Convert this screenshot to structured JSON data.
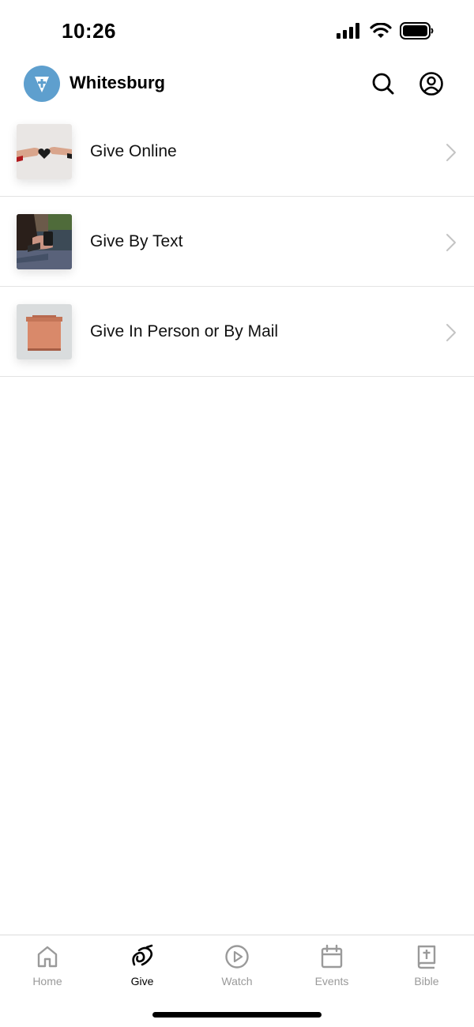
{
  "status_bar": {
    "time": "10:26",
    "icons": [
      "cellular-signal-icon",
      "wifi-icon",
      "battery-icon"
    ]
  },
  "header": {
    "church_name": "Whitesburg",
    "logo_color": "#5e9fce",
    "actions": [
      "search-icon",
      "account-icon"
    ]
  },
  "give_options": [
    {
      "label": "Give Online",
      "thumbnail": "hands-passing-heart"
    },
    {
      "label": "Give By Text",
      "thumbnail": "person-holding-phone"
    },
    {
      "label": "Give In Person or By Mail",
      "thumbnail": "copper-mailbox"
    }
  ],
  "tab_bar": {
    "active_color": "#000000",
    "inactive_color": "#9a9a9a",
    "tabs": [
      {
        "label": "Home",
        "icon": "home-icon",
        "active": false
      },
      {
        "label": "Give",
        "icon": "give-icon",
        "active": true
      },
      {
        "label": "Watch",
        "icon": "play-icon",
        "active": false
      },
      {
        "label": "Events",
        "icon": "calendar-icon",
        "active": false
      },
      {
        "label": "Bible",
        "icon": "bible-icon",
        "active": false
      }
    ]
  }
}
